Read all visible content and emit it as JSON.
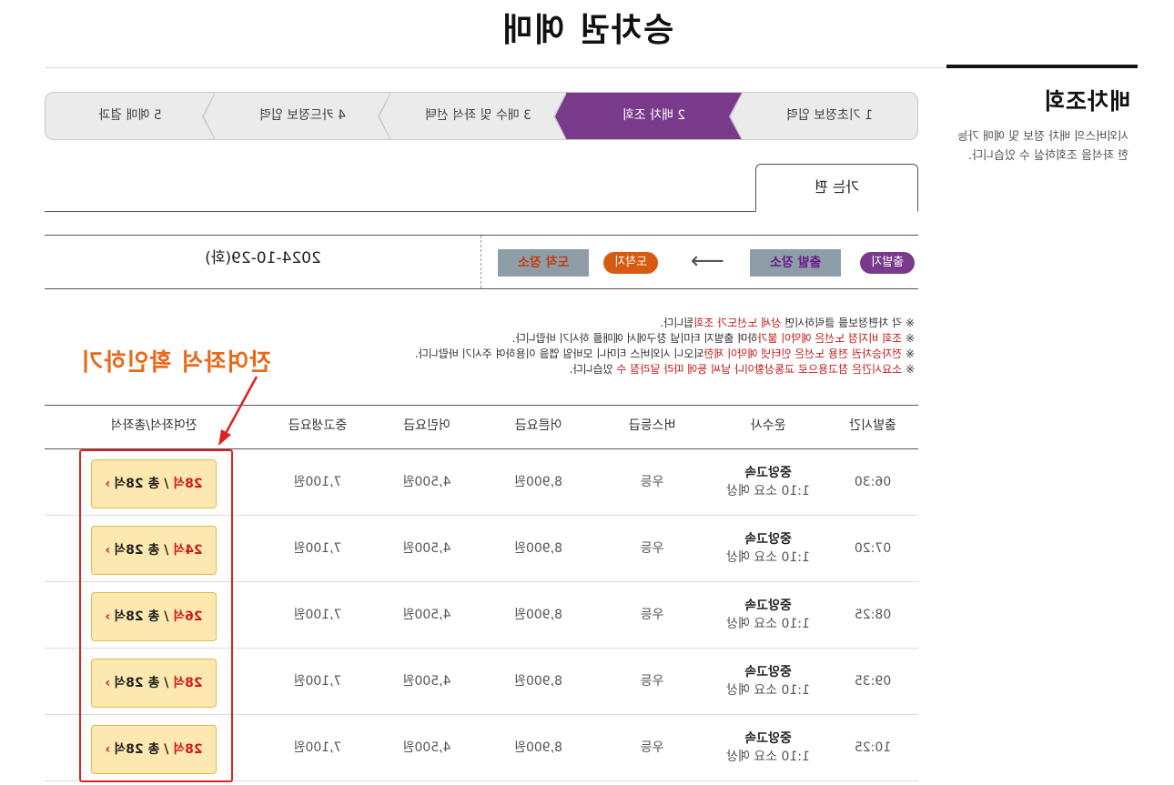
{
  "page": {
    "title": "승차권 예매"
  },
  "sidebar": {
    "title": "배차조회",
    "description": "시외버스의 배차 정보 및 예매 가능한 좌석을 조회하실 수 있습니다."
  },
  "steps": [
    {
      "label": "1 기초정보 입력",
      "active": false
    },
    {
      "label": "2 배차 조회",
      "active": true
    },
    {
      "label": "3 매수 및 좌석 선택",
      "active": false
    },
    {
      "label": "4 카드정보 입력",
      "active": false
    },
    {
      "label": "5 예매 결과",
      "active": false
    }
  ],
  "tabs": {
    "one_way": "가는 편"
  },
  "route": {
    "departure_badge": "출발지",
    "departure_station": "출발 장소",
    "arrival_badge": "도착지",
    "arrival_station": "도착 장소",
    "date": "2024-10-29(화)"
  },
  "notices": [
    {
      "mark": "※",
      "text": "각 차편정보를 클릭하시면 ",
      "red": "상세 노선도가 조회",
      "tail": "됩니다."
    },
    {
      "mark": "※",
      "text": "",
      "red": "조회 비지정 노선은 예약이 불가",
      "tail": "하며 출발지 터미널 창구에서 예매를 하시기 바랍니다."
    },
    {
      "mark": "※",
      "text": "",
      "red": "전자승차권 전용 노선은 인터넷 예약이 제한",
      "tail": "되오니 시외버스 티머니 모바일 앱을 이용하여 주시기 바랍니다."
    },
    {
      "mark": "※",
      "text": "",
      "red": "소요시간은 참고용으로 교통상황이나 날씨 등에 따라 달라질 수",
      "tail": " 있습니다."
    }
  ],
  "annotation": {
    "text": "잔여좌석 확인하기"
  },
  "table": {
    "headers": {
      "time": "출발시간",
      "company": "운수사",
      "grade": "버스등급",
      "adult": "어른요금",
      "child": "어린요금",
      "teen": "중고생요금",
      "seats": "잔여좌석/총좌석"
    },
    "rows": [
      {
        "time": "06:30",
        "company": "중앙고속",
        "duration": "1:10 소요 예상",
        "grade": "우등",
        "adult": "8,900원",
        "child": "4,500원",
        "teen": "7,100원",
        "remaining": "28석",
        "total": " / 총 28석"
      },
      {
        "time": "07:20",
        "company": "중앙고속",
        "duration": "1:10 소요 예상",
        "grade": "우등",
        "adult": "8,900원",
        "child": "4,500원",
        "teen": "7,100원",
        "remaining": "24석",
        "total": " / 총 28석"
      },
      {
        "time": "08:25",
        "company": "중앙고속",
        "duration": "1:10 소요 예상",
        "grade": "우등",
        "adult": "8,900원",
        "child": "4,500원",
        "teen": "7,100원",
        "remaining": "26석",
        "total": " / 총 28석"
      },
      {
        "time": "09:35",
        "company": "중앙고속",
        "duration": "1:10 소요 예상",
        "grade": "우등",
        "adult": "8,900원",
        "child": "4,500원",
        "teen": "7,100원",
        "remaining": "28석",
        "total": " / 총 28석"
      },
      {
        "time": "10:25",
        "company": "중앙고속",
        "duration": "1:10 소요 예상",
        "grade": "우등",
        "adult": "8,900원",
        "child": "4,500원",
        "teen": "7,100원",
        "remaining": "28석",
        "total": " / 총 28석"
      }
    ]
  },
  "colors": {
    "accent_purple": "#7a3a8c",
    "arrival_orange": "#d85a12",
    "seat_button": "#fde9b0",
    "highlight_red": "#e02020",
    "annotation_orange": "#e8691a"
  }
}
